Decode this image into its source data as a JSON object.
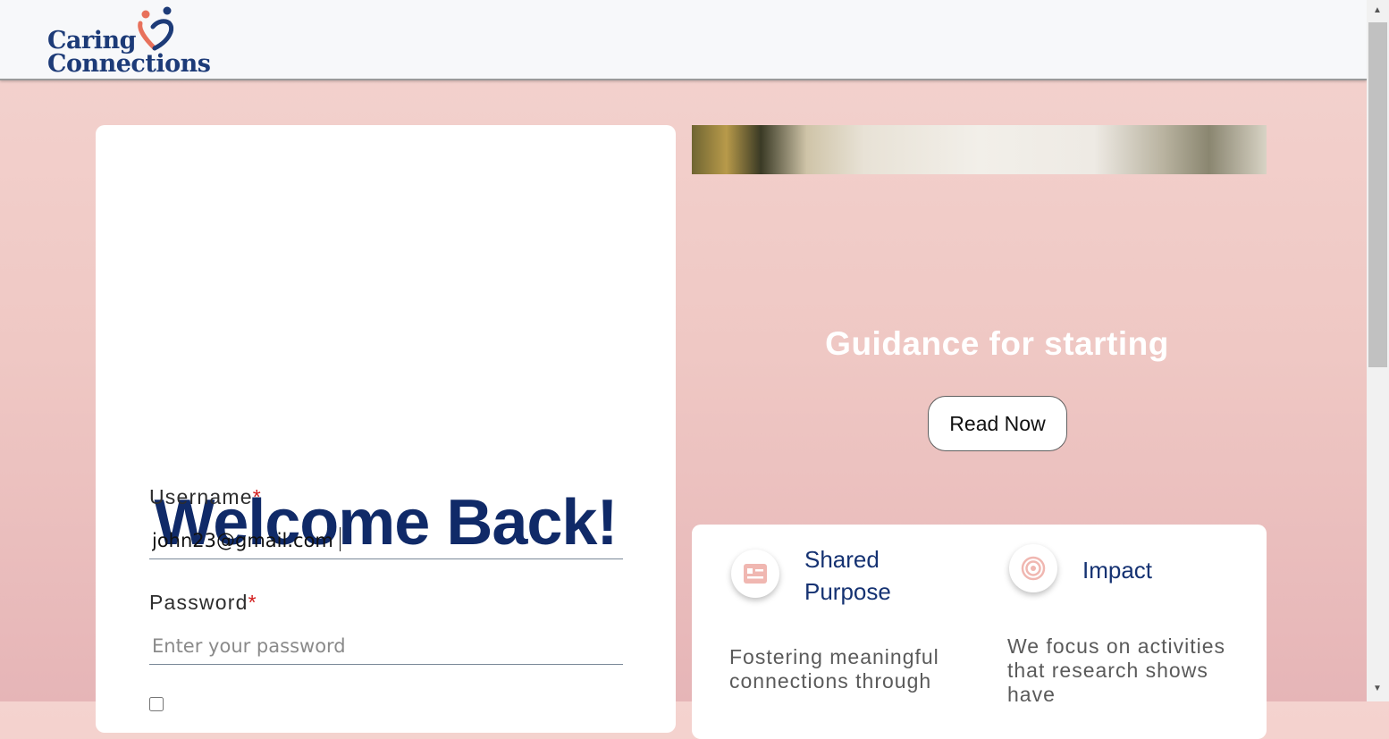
{
  "header": {
    "logo_line1": "Caring",
    "logo_line2": "Connections"
  },
  "login": {
    "title": "Welcome Back!",
    "username_label": "Username",
    "username_value": "john23@gmail.com",
    "password_label": "Password",
    "password_placeholder": "Enter your password",
    "required_mark": "*"
  },
  "hero": {
    "title": "Guidance for starting",
    "button_label": "Read Now"
  },
  "features": [
    {
      "icon": "list-card-icon",
      "title": "Shared Purpose",
      "description": "Fostering meaningful connections through"
    },
    {
      "icon": "target-icon",
      "title": "Impact",
      "description": "We focus on activities that research shows have"
    }
  ],
  "colors": {
    "brand_navy": "#102a68",
    "brand_coral": "#e8715c",
    "accent_pink": "#efc8c4",
    "required_red": "#d21b1b"
  }
}
